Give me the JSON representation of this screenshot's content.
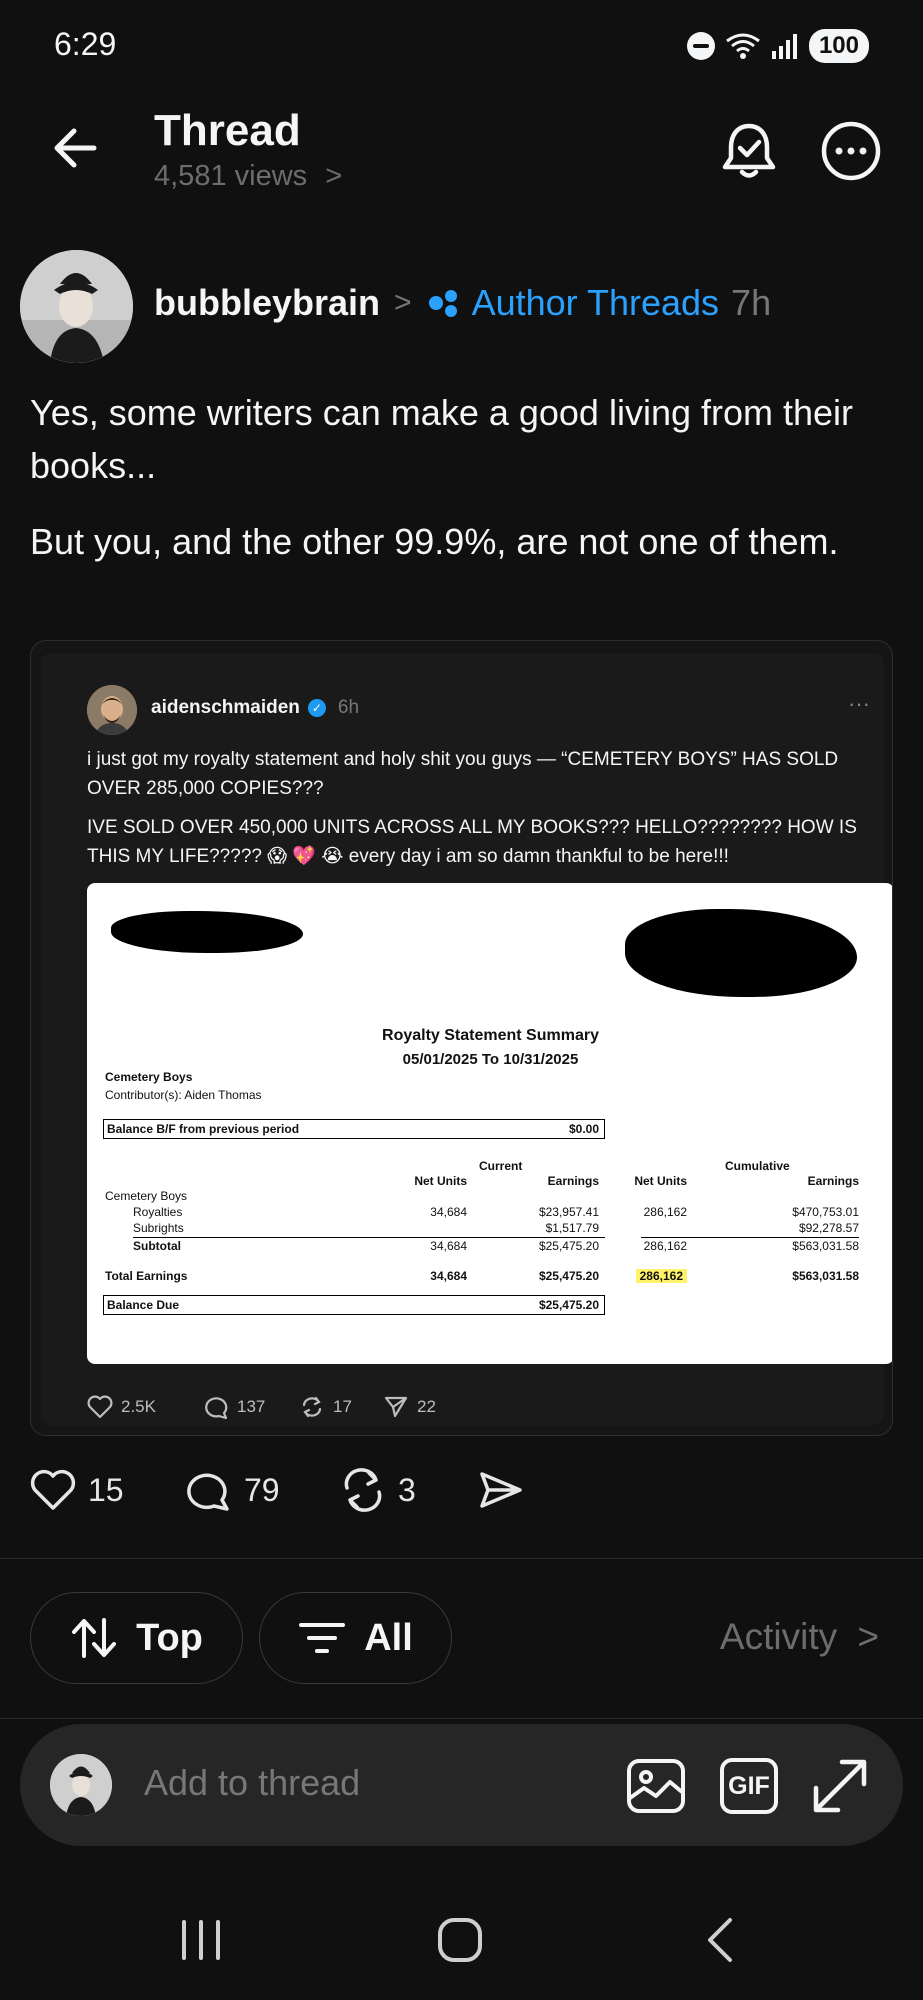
{
  "status_bar": {
    "time": "6:29",
    "battery": "100"
  },
  "header": {
    "title": "Thread",
    "views": "4,581 views",
    "views_chevron": ">"
  },
  "post": {
    "author": "bubbleybrain",
    "separator": ">",
    "community": "Author Threads",
    "time": "7h",
    "paragraphs": [
      "Yes, some writers can make a good living from their books...",
      "But you, and the other 99.9%, are not one of them."
    ],
    "actions": {
      "likes": "15",
      "replies": "79",
      "reposts": "3"
    }
  },
  "quoted_post": {
    "author": "aidenschmaiden",
    "time": "6h",
    "paragraphs": [
      "i just got my royalty statement and holy shit you guys — “CEMETERY BOYS” HAS SOLD OVER 285,000 COPIES???",
      "IVE SOLD OVER 450,000 UNITS ACROSS ALL MY BOOKS??? HELLO???????? HOW IS THIS MY LIFE????? 😱 💖 😭  every day i am so damn thankful to be here!!!"
    ],
    "actions": {
      "likes": "2.5K",
      "replies": "137",
      "reposts": "17",
      "shares": "22"
    }
  },
  "statement": {
    "title": "Royalty Statement Summary",
    "period": "05/01/2025 To 10/31/2025",
    "book": "Cemetery Boys",
    "contributors": "Contributor(s): Aiden Thomas",
    "balance_bf_label": "Balance B/F from previous period",
    "balance_bf_value": "$0.00",
    "current_label": "Current",
    "cumulative_label": "Cumulative",
    "col_net_units": "Net Units",
    "col_earnings": "Earnings",
    "section": "Cemetery Boys",
    "rows": [
      {
        "label": "Royalties",
        "cur_units": "34,684",
        "cur_earn": "$23,957.41",
        "cum_units": "286,162",
        "cum_earn": "$470,753.01"
      },
      {
        "label": "Subrights",
        "cur_units": "",
        "cur_earn": "$1,517.79",
        "cum_units": "",
        "cum_earn": "$92,278.57"
      },
      {
        "label": "Subtotal",
        "cur_units": "34,684",
        "cur_earn": "$25,475.20",
        "cum_units": "286,162",
        "cum_earn": "$563,031.58"
      }
    ],
    "total": {
      "label": "Total Earnings",
      "cur_units": "34,684",
      "cur_earn": "$25,475.20",
      "cum_units": "286,162",
      "cum_earn": "$563,031.58"
    },
    "balance_due_label": "Balance Due",
    "balance_due_value": "$25,475.20"
  },
  "filters": {
    "sort": "Top",
    "filter": "All",
    "activity": "Activity",
    "activity_chevron": ">"
  },
  "compose": {
    "placeholder": "Add to thread",
    "gif": "GIF"
  }
}
